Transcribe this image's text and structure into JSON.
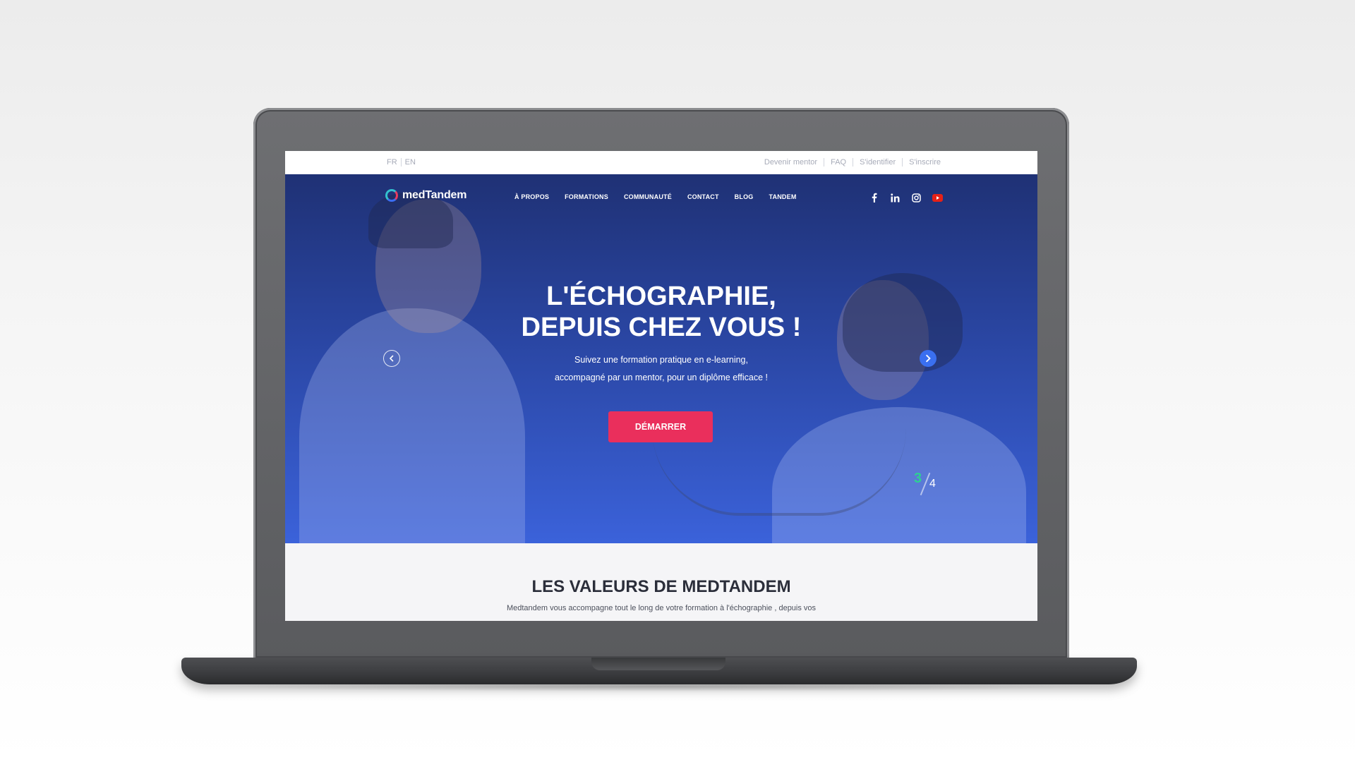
{
  "topbar": {
    "languages": [
      "FR",
      "EN"
    ],
    "links": [
      "Devenir mentor",
      "FAQ",
      "S'identifier",
      "S'inscrire"
    ]
  },
  "nav": {
    "logo_text": "medTandem",
    "menu": [
      "À PROPOS",
      "FORMATIONS",
      "COMMUNAUTÉ",
      "CONTACT",
      "BLOG",
      "TANDEM"
    ],
    "socials": [
      "facebook-icon",
      "linkedin-icon",
      "instagram-icon",
      "youtube-icon"
    ]
  },
  "hero": {
    "headline_line1": "L'ÉCHOGRAPHIE,",
    "headline_line2": "DEPUIS CHEZ VOUS !",
    "subline_line1": "Suivez une formation pratique en e-learning,",
    "subline_line2": "accompagné par un mentor,  pour un diplôme efficace !",
    "cta_label": "DÉMARRER",
    "slide_current": "3",
    "slide_total": "4"
  },
  "values": {
    "title": "LES VALEURS DE MEDTANDEM",
    "text": "Medtandem vous accompagne tout le long de votre formation à l'échographie , depuis vos"
  },
  "colors": {
    "hero_top": "#1f3175",
    "hero_bottom": "#3b62da",
    "cta": "#ea2f5c",
    "counter_accent": "#2ecf93",
    "youtube": "#e62117"
  }
}
